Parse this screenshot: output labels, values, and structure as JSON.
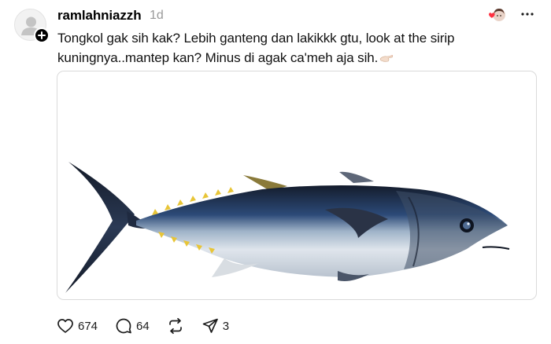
{
  "post": {
    "username": "ramlahniazzh",
    "time": "1d",
    "text": "Tongkol gak sih kak? Lebih ganteng dan lakikkk gtu, look at the sirip kuningnya..mantep kan? Minus di agak ca'meh aja sih."
  },
  "media": {
    "icon": "bluefin-tuna-photo"
  },
  "actions": {
    "likes": "674",
    "comments": "64",
    "shares": "3"
  },
  "colors": {
    "like_badge": "#ff3040",
    "muted": "#9a9a9a",
    "fish_back": "#1c2536",
    "fish_fin": "#e8c537"
  }
}
